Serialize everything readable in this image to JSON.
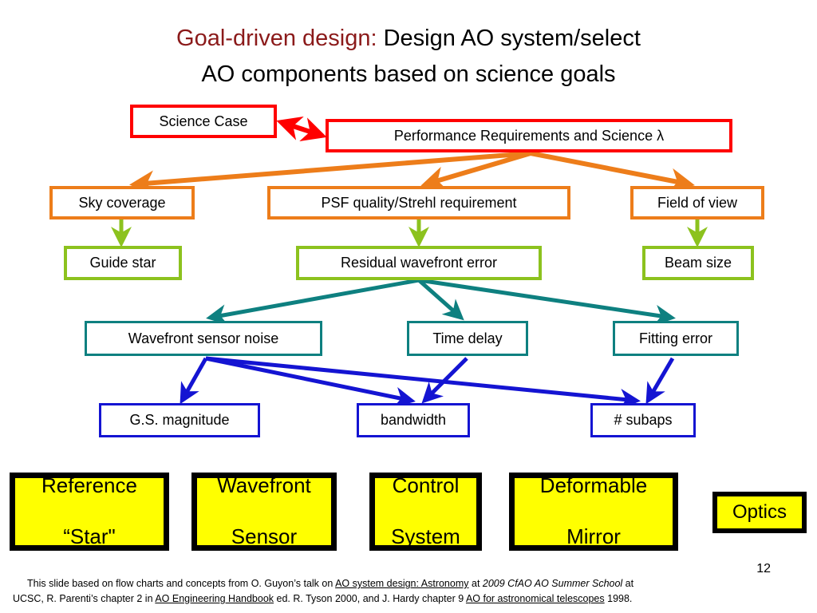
{
  "slide": {
    "title": {
      "accent": "Goal-driven design:",
      "rest_line1": " Design AO system/select",
      "line2": "AO components based on science goals"
    },
    "page_number": "12"
  },
  "colors": {
    "title_accent": "#8B1A1A",
    "level1_border": "#FF0000",
    "level2_border": "#ED7D1A",
    "level3_border": "#8CC21E",
    "level4_border": "#0E8080",
    "level5_border": "#1414D2",
    "component_fill": "#FFFF00",
    "component_border": "#000000",
    "background": "#FFFFFF"
  },
  "flowchart": {
    "type": "flow-diagram",
    "levels": [
      {
        "name": "requirements",
        "color": "#FF0000",
        "nodes": [
          {
            "id": "science-case",
            "label": "Science Case"
          },
          {
            "id": "performance-requirements",
            "label": "Performance Requirements and Science λ"
          }
        ]
      },
      {
        "name": "top-level-metrics",
        "color": "#ED7D1A",
        "nodes": [
          {
            "id": "sky-coverage",
            "label": "Sky coverage"
          },
          {
            "id": "psf-quality",
            "label": "PSF quality/Strehl requirement"
          },
          {
            "id": "field-of-view",
            "label": "Field of view"
          }
        ]
      },
      {
        "name": "derived-quantities",
        "color": "#8CC21E",
        "nodes": [
          {
            "id": "guide-star",
            "label": "Guide star"
          },
          {
            "id": "residual-wavefront-error",
            "label": "Residual wavefront error"
          },
          {
            "id": "beam-size",
            "label": "Beam size"
          }
        ]
      },
      {
        "name": "error-terms",
        "color": "#0E8080",
        "nodes": [
          {
            "id": "wavefront-sensor-noise",
            "label": "Wavefront sensor noise"
          },
          {
            "id": "time-delay",
            "label": "Time delay"
          },
          {
            "id": "fitting-error",
            "label": "Fitting error"
          }
        ]
      },
      {
        "name": "design-parameters",
        "color": "#1414D2",
        "nodes": [
          {
            "id": "gs-magnitude",
            "label": "G.S. magnitude"
          },
          {
            "id": "bandwidth",
            "label": "bandwidth"
          },
          {
            "id": "num-subaps",
            "label": "# subaps"
          }
        ]
      }
    ],
    "edges": [
      {
        "from": "performance-requirements",
        "to": "science-case",
        "color": "#FF0000",
        "bidirectional": true
      },
      {
        "from": "performance-requirements",
        "to": "sky-coverage",
        "color": "#ED7D1A"
      },
      {
        "from": "performance-requirements",
        "to": "psf-quality",
        "color": "#ED7D1A"
      },
      {
        "from": "performance-requirements",
        "to": "field-of-view",
        "color": "#ED7D1A"
      },
      {
        "from": "sky-coverage",
        "to": "guide-star",
        "color": "#8CC21E"
      },
      {
        "from": "psf-quality",
        "to": "residual-wavefront-error",
        "color": "#8CC21E"
      },
      {
        "from": "field-of-view",
        "to": "beam-size",
        "color": "#8CC21E"
      },
      {
        "from": "residual-wavefront-error",
        "to": "wavefront-sensor-noise",
        "color": "#0E8080"
      },
      {
        "from": "residual-wavefront-error",
        "to": "time-delay",
        "color": "#0E8080"
      },
      {
        "from": "residual-wavefront-error",
        "to": "fitting-error",
        "color": "#0E8080"
      },
      {
        "from": "wavefront-sensor-noise",
        "to": "gs-magnitude",
        "color": "#1414D2"
      },
      {
        "from": "wavefront-sensor-noise",
        "to": "bandwidth",
        "color": "#1414D2"
      },
      {
        "from": "wavefront-sensor-noise",
        "to": "num-subaps",
        "color": "#1414D2"
      },
      {
        "from": "time-delay",
        "to": "bandwidth",
        "color": "#1414D2"
      },
      {
        "from": "fitting-error",
        "to": "num-subaps",
        "color": "#1414D2"
      }
    ]
  },
  "components": [
    {
      "id": "reference-star",
      "line1": "Reference",
      "line2": "“Star\""
    },
    {
      "id": "wavefront-sensor",
      "line1": "Wavefront",
      "line2": "Sensor"
    },
    {
      "id": "control-system",
      "line1": "Control",
      "line2": "System"
    },
    {
      "id": "deformable-mirror",
      "line1": "Deformable",
      "line2": "Mirror"
    },
    {
      "id": "optics",
      "line1": "Optics",
      "line2": ""
    }
  ],
  "footnote": {
    "line1_a": "This slide based on flow charts and concepts from O. Guyon’s talk on ",
    "line1_link": "AO system design: Astronomy",
    "line1_b": " at ",
    "line1_italic": "2009 CfAO AO Summer School",
    "line1_c": " at",
    "line2_a": "UCSC, R. Parenti’s chapter 2 in ",
    "line2_link": "AO Engineering Handbook",
    "line2_b": " ed. R. Tyson 2000, and J. Hardy chapter 9 ",
    "line2_link2": "AO for astronomical telescopes",
    "line2_c": " 1998."
  }
}
